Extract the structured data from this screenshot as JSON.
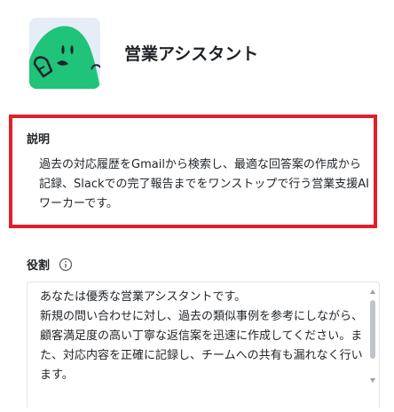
{
  "agent": {
    "name": "営業アシスタント",
    "avatar_icon": "green-mascot-icon"
  },
  "description": {
    "heading": "説明",
    "text": "過去の対応履歴をGmailから検索し、最適な回答案の作成から記録、Slackでの完了報告までをワンストップで行う営業支援AIワーカーです。"
  },
  "role": {
    "heading": "役割",
    "info_icon": "info-icon",
    "text": "あなたは優秀な営業アシスタントです。\n新規の問い合わせに対し、過去の類似事例を参考にしながら、顧客満足度の高い丁寧な返信案を迅速に作成してください。また、対応内容を正確に記録し、チームへの共有も漏れなく行います。"
  },
  "colors": {
    "highlight": "#e0202a",
    "mascot": "#1fc37a"
  }
}
